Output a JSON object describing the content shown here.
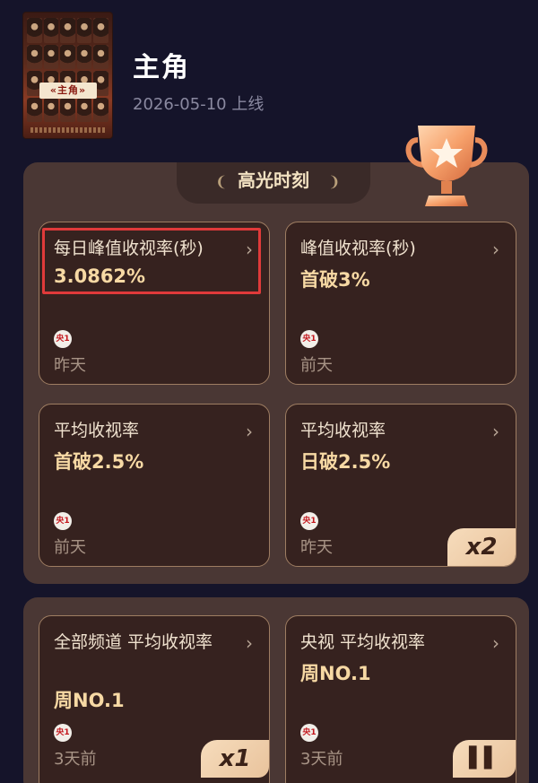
{
  "show": {
    "poster_title": "«主角»",
    "title": "主角",
    "release": "2026-05-10 上线"
  },
  "section": {
    "title": "高光时刻"
  },
  "cards": [
    {
      "title": "每日峰值收视率(秒)",
      "value": "3.0862%",
      "channel": "央1",
      "time": "昨天",
      "arrow": "›"
    },
    {
      "title": "峰值收视率(秒)",
      "value": "首破3%",
      "channel": "央1",
      "time": "前天",
      "arrow": "›"
    },
    {
      "title": "平均收视率",
      "value": "首破2.5%",
      "channel": "央1",
      "time": "前天",
      "arrow": "›"
    },
    {
      "title": "平均收视率",
      "value": "日破2.5%",
      "channel": "央1",
      "time": "昨天",
      "arrow": "›",
      "multiplier": "x2"
    },
    {
      "title": "全部频道 平均收视率",
      "value": "周NO.1",
      "channel": "央1",
      "time": "3天前",
      "arrow": "›",
      "multiplier": "x1"
    },
    {
      "title": "央视 平均收视率",
      "value": "周NO.1",
      "channel": "央1",
      "time": "3天前",
      "arrow": "›"
    }
  ],
  "colors": {
    "background": "#15142a",
    "panel": "#4a3734",
    "card": "#36221f",
    "value": "#f7d9a4",
    "highlight": "#e03a3a"
  },
  "icons": [
    "trophy-icon",
    "cctv1-logo-icon",
    "chevron-right-icon",
    "laurel-left-icon",
    "laurel-right-icon"
  ]
}
